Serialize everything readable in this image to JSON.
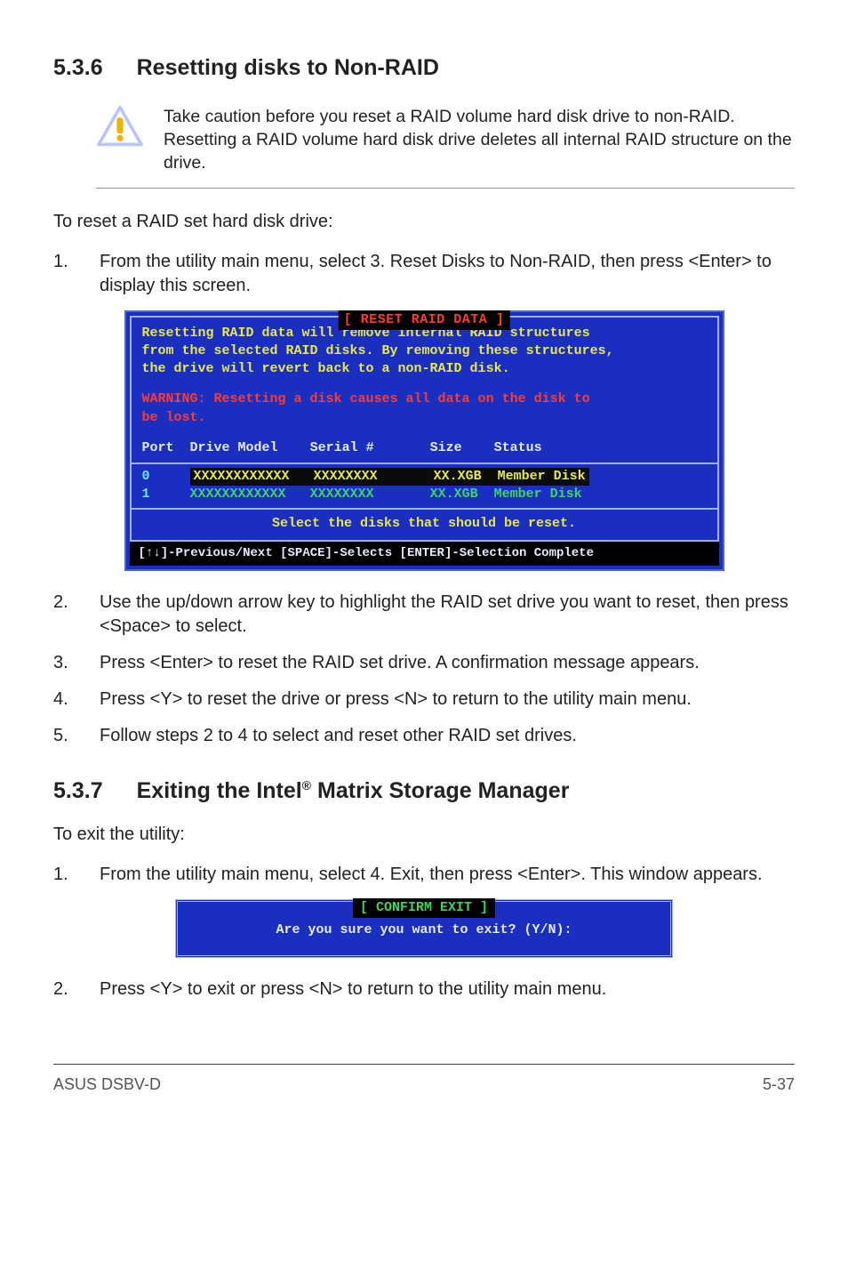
{
  "section1": {
    "number": "5.3.6",
    "title": "Resetting disks to Non-RAID",
    "callout": "Take caution before you reset a RAID volume hard disk drive to non-RAID. Resetting a RAID volume hard disk drive deletes all internal RAID structure on the drive.",
    "intro": "To reset a RAID set hard disk drive:",
    "step1": "From the utility main menu, select 3. Reset Disks to Non-RAID, then press <Enter> to display this screen.",
    "step2": "Use the up/down arrow key to highlight the RAID set drive you want to reset, then press <Space> to select.",
    "step3": "Press <Enter> to reset the RAID set drive. A confirmation message appears.",
    "step4": "Press <Y> to reset the drive or press <N> to return to the utility main menu.",
    "step5": "Follow steps 2 to 4 to select and reset other RAID set drives."
  },
  "terminal1": {
    "title": "[ RESET RAID DATA ]",
    "line1": "Resetting RAID data will remove internal RAID structures",
    "line2": "from the selected RAID disks. By removing these structures,",
    "line3": "the drive will revert back to a non-RAID disk.",
    "warn1": "WARNING: Resetting a disk causes all data on the disk to",
    "warn2": "be lost.",
    "hdr_port": "Port",
    "hdr_model": "Drive Model",
    "hdr_serial": "Serial #",
    "hdr_size": "Size",
    "hdr_status": "Status",
    "row0": {
      "port": "0",
      "model": "XXXXXXXXXXXX",
      "serial": "XXXXXXXX",
      "size": "XX.XGB",
      "status": "Member Disk"
    },
    "row1": {
      "port": "1",
      "model": "XXXXXXXXXXXX",
      "serial": "XXXXXXXX",
      "size": "XX.XGB",
      "status": "Member Disk"
    },
    "select_prompt": "Select the disks that should be reset.",
    "footer": "[↑↓]-Previous/Next  [SPACE]-Selects  [ENTER]-Selection Complete"
  },
  "section2": {
    "number": "5.3.7",
    "title_pre": "Exiting the Intel",
    "title_sup": "®",
    "title_post": " Matrix Storage Manager",
    "intro": "To exit the utility:",
    "step1": "From the utility main menu, select 4. Exit, then press <Enter>. This window appears.",
    "step2": "Press <Y> to exit or press <N> to return to the utility main menu."
  },
  "terminal2": {
    "title": "[ CONFIRM EXIT ]",
    "body": "Are you sure you want to exit? (Y/N):"
  },
  "footer": {
    "left": "ASUS DSBV-D",
    "right": "5-37"
  }
}
